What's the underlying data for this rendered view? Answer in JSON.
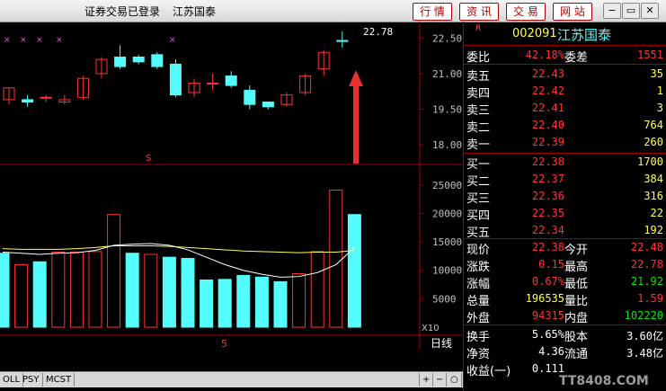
{
  "titlebar": {
    "status": "证券交易已登录",
    "stock_name": "江苏国泰",
    "buttons": [
      "行 情",
      "资 讯",
      "交 易",
      "网 站"
    ],
    "win_controls": [
      "−",
      "▭",
      "✕"
    ]
  },
  "chart_data": [
    {
      "type": "candlestick",
      "y_ticks": [
        "22.50",
        "21.00",
        "19.50",
        "18.00"
      ],
      "ylim": [
        17.2,
        23.2
      ],
      "last_price_label": "22.78",
      "candles": [
        {
          "open": 19.9,
          "high": 20.4,
          "low": 19.7,
          "close": 20.4
        },
        {
          "open": 19.9,
          "high": 20.1,
          "low": 19.6,
          "close": 19.8
        },
        {
          "open": 20.0,
          "high": 20.1,
          "low": 19.8,
          "close": 20.0
        },
        {
          "open": 19.8,
          "high": 20.1,
          "low": 19.7,
          "close": 19.9
        },
        {
          "open": 20.0,
          "high": 20.9,
          "low": 19.9,
          "close": 20.8
        },
        {
          "open": 21.0,
          "high": 21.7,
          "low": 20.8,
          "close": 21.6
        },
        {
          "open": 21.7,
          "high": 22.2,
          "low": 21.2,
          "close": 21.3
        },
        {
          "open": 21.7,
          "high": 21.8,
          "low": 21.4,
          "close": 21.5
        },
        {
          "open": 21.8,
          "high": 21.9,
          "low": 21.2,
          "close": 21.3
        },
        {
          "open": 21.4,
          "high": 21.6,
          "low": 20.0,
          "close": 20.1
        },
        {
          "open": 20.2,
          "high": 20.8,
          "low": 20.0,
          "close": 20.6
        },
        {
          "open": 20.6,
          "high": 21.0,
          "low": 20.3,
          "close": 20.6
        },
        {
          "open": 20.9,
          "high": 21.1,
          "low": 20.4,
          "close": 20.5
        },
        {
          "open": 20.3,
          "high": 20.5,
          "low": 19.5,
          "close": 19.7
        },
        {
          "open": 19.8,
          "high": 19.8,
          "low": 19.5,
          "close": 19.6
        },
        {
          "open": 19.7,
          "high": 20.2,
          "low": 19.6,
          "close": 20.1
        },
        {
          "open": 20.2,
          "high": 21.0,
          "low": 20.1,
          "close": 20.9
        },
        {
          "open": 21.2,
          "high": 22.0,
          "low": 20.9,
          "close": 21.9
        },
        {
          "open": 22.4,
          "high": 22.78,
          "low": 22.1,
          "close": 22.38
        }
      ]
    },
    {
      "type": "bar",
      "y_ticks": [
        "25000",
        "20000",
        "15000",
        "10000",
        "5000"
      ],
      "ylim": [
        0,
        27500
      ],
      "unit": "X10",
      "volumes": [
        13000,
        11000,
        11500,
        13200,
        13200,
        13300,
        19800,
        13000,
        12800,
        12300,
        12100,
        8300,
        8400,
        9100,
        8800,
        8000,
        9400,
        13300,
        24100,
        19800
      ],
      "up": [
        true,
        false,
        true,
        false,
        false,
        false,
        false,
        true,
        false,
        true,
        true,
        true,
        true,
        true,
        true,
        true,
        false,
        false,
        false,
        true
      ],
      "ma1": [
        13200,
        13000,
        12800,
        13000,
        13100,
        13500,
        14400,
        14600,
        14700,
        14400,
        13600,
        12300,
        11000,
        10000,
        9300,
        8800,
        8900,
        9600,
        11000,
        14000
      ],
      "ma2": [
        13800,
        13700,
        13700,
        13700,
        13800,
        14000,
        14300,
        14300,
        14300,
        14200,
        14000,
        13800,
        13600,
        13400,
        13300,
        13200,
        13100,
        13200,
        13200,
        13500
      ]
    }
  ],
  "chart_labels": {
    "period": "日线",
    "s_mark": "S",
    "five_mark": "5"
  },
  "tabs": [
    "OLL",
    "PSY",
    "MCST"
  ],
  "scroll_controls": [
    "+",
    "−",
    "○"
  ],
  "panel": {
    "r_mark": "R",
    "code": "002091",
    "name": "江苏国泰",
    "weibi": {
      "label": "委比",
      "value": "42.18%",
      "label2": "委差",
      "value2": "1551"
    },
    "asks": [
      {
        "label": "卖五",
        "price": "22.43",
        "vol": "35"
      },
      {
        "label": "卖四",
        "price": "22.42",
        "vol": "1"
      },
      {
        "label": "卖三",
        "price": "22.41",
        "vol": "3"
      },
      {
        "label": "卖二",
        "price": "22.40",
        "vol": "764"
      },
      {
        "label": "卖一",
        "price": "22.39",
        "vol": "260"
      }
    ],
    "bids": [
      {
        "label": "买一",
        "price": "22.38",
        "vol": "1700"
      },
      {
        "label": "买二",
        "price": "22.37",
        "vol": "384"
      },
      {
        "label": "买三",
        "price": "22.36",
        "vol": "316"
      },
      {
        "label": "买四",
        "price": "22.35",
        "vol": "22"
      },
      {
        "label": "买五",
        "price": "22.34",
        "vol": "192"
      }
    ],
    "stats": [
      {
        "l1": "现价",
        "v1": "22.38",
        "l2": "今开",
        "v2": "22.48"
      },
      {
        "l1": "涨跌",
        "v1": "0.15",
        "l2": "最高",
        "v2": "22.78"
      },
      {
        "l1": "涨幅",
        "v1": "0.67%",
        "l2": "最低",
        "v2": "21.92"
      },
      {
        "l1": "总量",
        "v1": "196535",
        "l2": "量比",
        "v2": "1.59"
      },
      {
        "l1": "外盘",
        "v1": "94315",
        "l2": "内盘",
        "v2": "102220"
      }
    ],
    "stats2": [
      {
        "l1": "换手",
        "v1": "5.65%",
        "l2": "股本",
        "v2": "3.60亿"
      },
      {
        "l1": "净资",
        "v1": "4.36",
        "l2": "流通",
        "v2": "3.48亿"
      },
      {
        "l1": "收益(一)",
        "v1": "0.111",
        "l2": "",
        "v2": ""
      }
    ],
    "watermark": "TT8408.COM"
  },
  "colors": {
    "up": "#ff3232",
    "down": "#54fcfc",
    "green": "#00e600",
    "yellow": "#ffff54",
    "grid": "#a00000",
    "axis_text": "#c0c0c0"
  }
}
